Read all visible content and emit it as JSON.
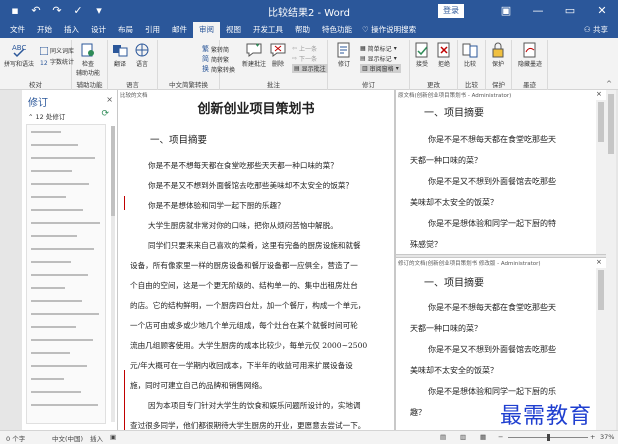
{
  "window": {
    "title": "比较结果2 - Word",
    "login": "登录",
    "minimize": "—",
    "restore": "▭",
    "close": "✕"
  },
  "qat": {
    "save": "▪",
    "undo": "↶",
    "redo": "↷",
    "repeat": "✓",
    "more": "▾"
  },
  "tabs": [
    {
      "label": "文件"
    },
    {
      "label": "开始"
    },
    {
      "label": "插入"
    },
    {
      "label": "设计"
    },
    {
      "label": "布局"
    },
    {
      "label": "引用"
    },
    {
      "label": "邮件"
    },
    {
      "label": "审阅"
    },
    {
      "label": "视图"
    },
    {
      "label": "开发工具"
    },
    {
      "label": "帮助"
    },
    {
      "label": "特色功能"
    }
  ],
  "active_tab": 7,
  "tell_me": "操作说明搜索",
  "share": "共享",
  "ribbon": {
    "groups": [
      {
        "label": "校对",
        "buttons": [
          "拼写和语法",
          "同义词库",
          "字数统计"
        ]
      },
      {
        "label": "辅助功能",
        "buttons": [
          "检查",
          "辅助功能"
        ]
      },
      {
        "label": "语言",
        "buttons": [
          "翻译",
          "语言"
        ]
      },
      {
        "label": "中文简繁转换",
        "buttons": [
          "繁转简",
          "简转繁",
          "简繁转换"
        ]
      },
      {
        "label": "批注",
        "buttons": [
          "新建批注",
          "删除",
          "上一条",
          "下一条",
          "显示批注"
        ]
      },
      {
        "label": "修订",
        "buttons": [
          "修订",
          "简单标记",
          "显示标记",
          "审阅窗格"
        ]
      },
      {
        "label": "更改",
        "buttons": [
          "接受",
          "拒绝"
        ]
      },
      {
        "label": "比较",
        "buttons": [
          "比较"
        ]
      },
      {
        "label": "保护",
        "buttons": [
          "保护"
        ]
      },
      {
        "label": "墨迹",
        "buttons": [
          "隐藏墨迹"
        ]
      }
    ]
  },
  "revision_pane": {
    "title": "修订",
    "close": "×",
    "summary": "12 处修订",
    "refresh": "⟳"
  },
  "compared_doc": {
    "header": "比较的文档",
    "title": "创新创业项目策划书",
    "heading": "一、项目摘要",
    "paragraphs": [
      "你是不是不想每天都在食堂吃那些天天都一种口味的菜？",
      "你是不是又不想到外面餐馆去吃那些美味却不太安全的饭菜？",
      "你是不是想体验和同学一起下厨的乐趣？",
      "大学生厨房就非常对你的口味，把你从烦闷苦恼中解脱。",
      "同学们只要来来自己喜欢的菜肴，这里有完备的厨房设施和就餐",
      "设备，所有像家里一样的厨房设备和餐厅设备都一应俱全，营造了一",
      "个自由的空间，这是一个更无阶级的、结构单一的、集中出租房灶台",
      "的店。它的结构鲜明，一个厨房四台灶，加一个餐厅，构成一个单元，",
      "一个店可由或多或少地几个单元组成，每个灶台在某个就餐时间可轮",
      "流由几组顾客使用。大学生厨房的成本比较少，每单元仅 2000~2500",
      "元/年大概可在一学期内收回成本，下半年的收益可用来扩展设备设",
      "施，同时可建立自己的品牌和销售网络。",
      "因为本项目专门针对大学生的饮食和娱乐问题所设计的，实地调",
      "查过很多同学，他们都很期待大学生厨房的开业，更愿意去尝试一下。"
    ]
  },
  "original_doc": {
    "header": "原文档(创新创业项目策划书 - Administrator)",
    "heading": "一、项目摘要",
    "paragraphs": [
      "你是不是不想每天都在食堂吃那些天",
      "天都一种口味的菜？",
      "你是不是又不想到外面餐馆去吃那些",
      "美味却不太安全的饭菜？",
      "你是不是想体验和同学一起下厨的特",
      "殊感觉？"
    ]
  },
  "revised_doc": {
    "header": "修订的文档(创新创业项目策划书 修改版 - Administrator)",
    "heading": "一、项目摘要",
    "paragraphs": [
      "你是不是不想每天都在食堂吃那些天",
      "天都一种口味的菜？",
      "你是不是又不想到外面餐馆去吃那些",
      "美味却不太安全的饭菜？",
      "你是不是想体验和同学一起下厨的乐",
      "趣？"
    ]
  },
  "statusbar": {
    "words": "0 个字",
    "language": "中文(中国)",
    "mode": "插入",
    "zoom_minus": "−",
    "zoom_plus": "+",
    "zoom": "37%",
    "zoom_fraction": 0.37
  },
  "watermark": "最需教育"
}
